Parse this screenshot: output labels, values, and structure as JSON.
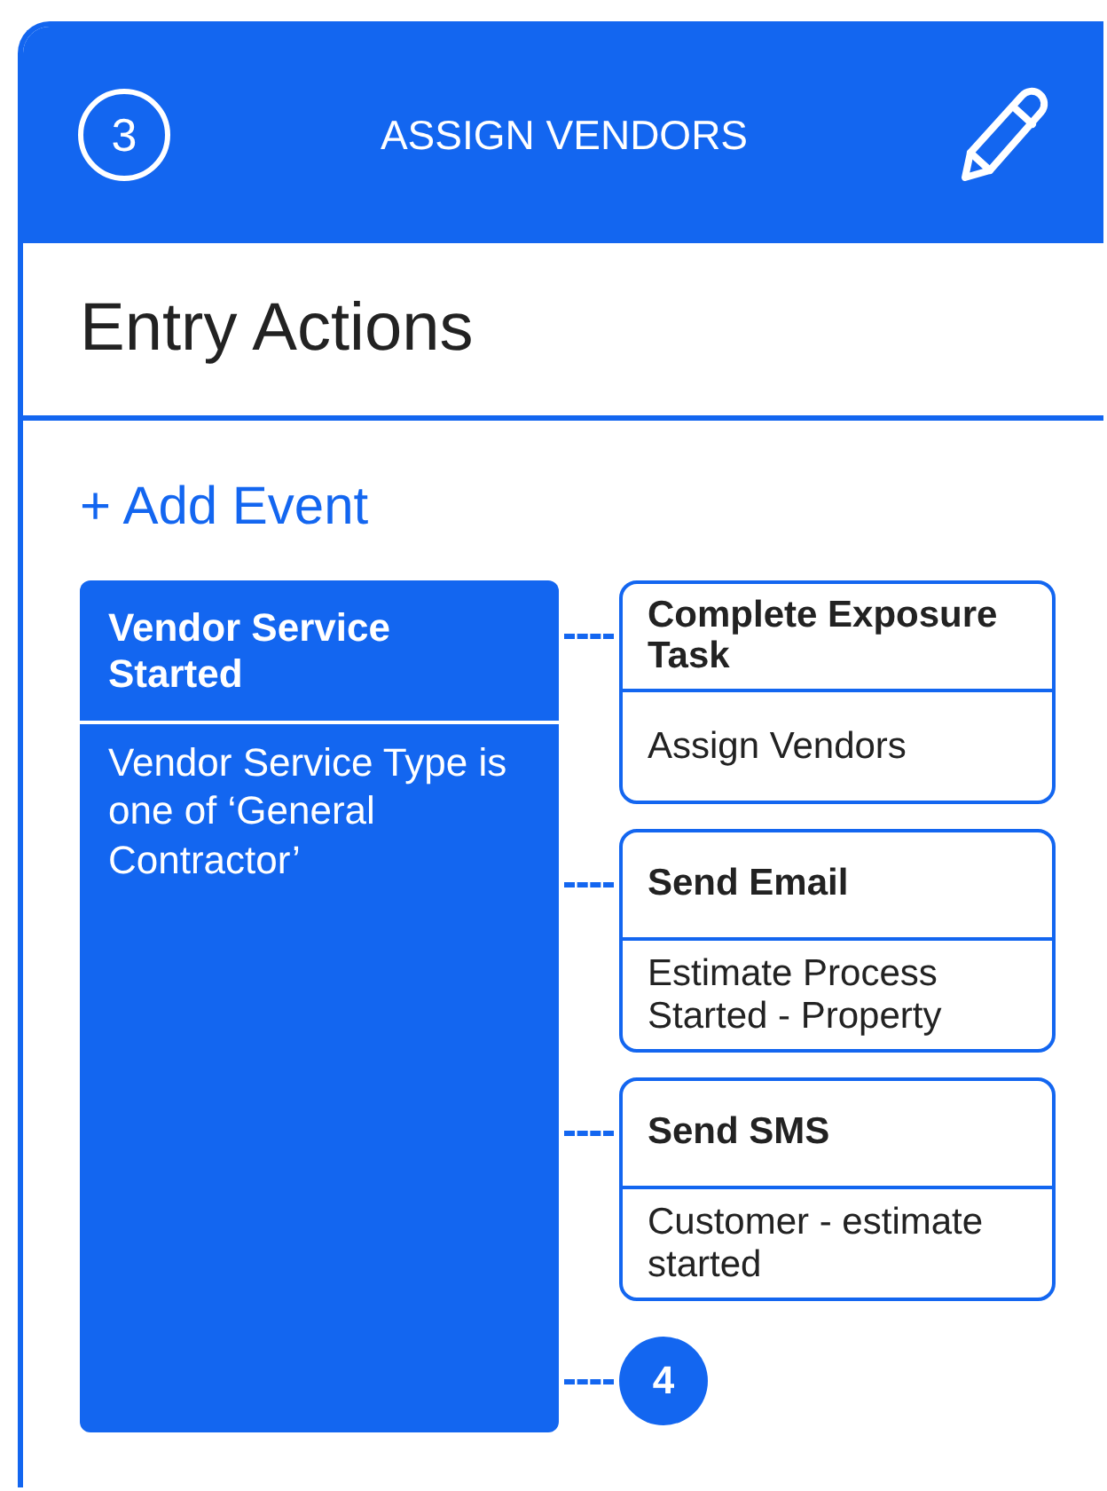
{
  "header": {
    "step": "3",
    "title": "ASSIGN VENDORS"
  },
  "section_title": "Entry Actions",
  "add_event": "+ Add Event",
  "trigger": {
    "title": "Vendor Service Started",
    "condition": "Vendor Service Type is one of ‘General Contractor’"
  },
  "actions": [
    {
      "title": "Complete Exposure Task",
      "detail": "Assign Vendors"
    },
    {
      "title": "Send Email",
      "detail": "Estimate Process Started - Property"
    },
    {
      "title": "Send SMS",
      "detail": "Customer - estimate started"
    }
  ],
  "next_step": "4"
}
